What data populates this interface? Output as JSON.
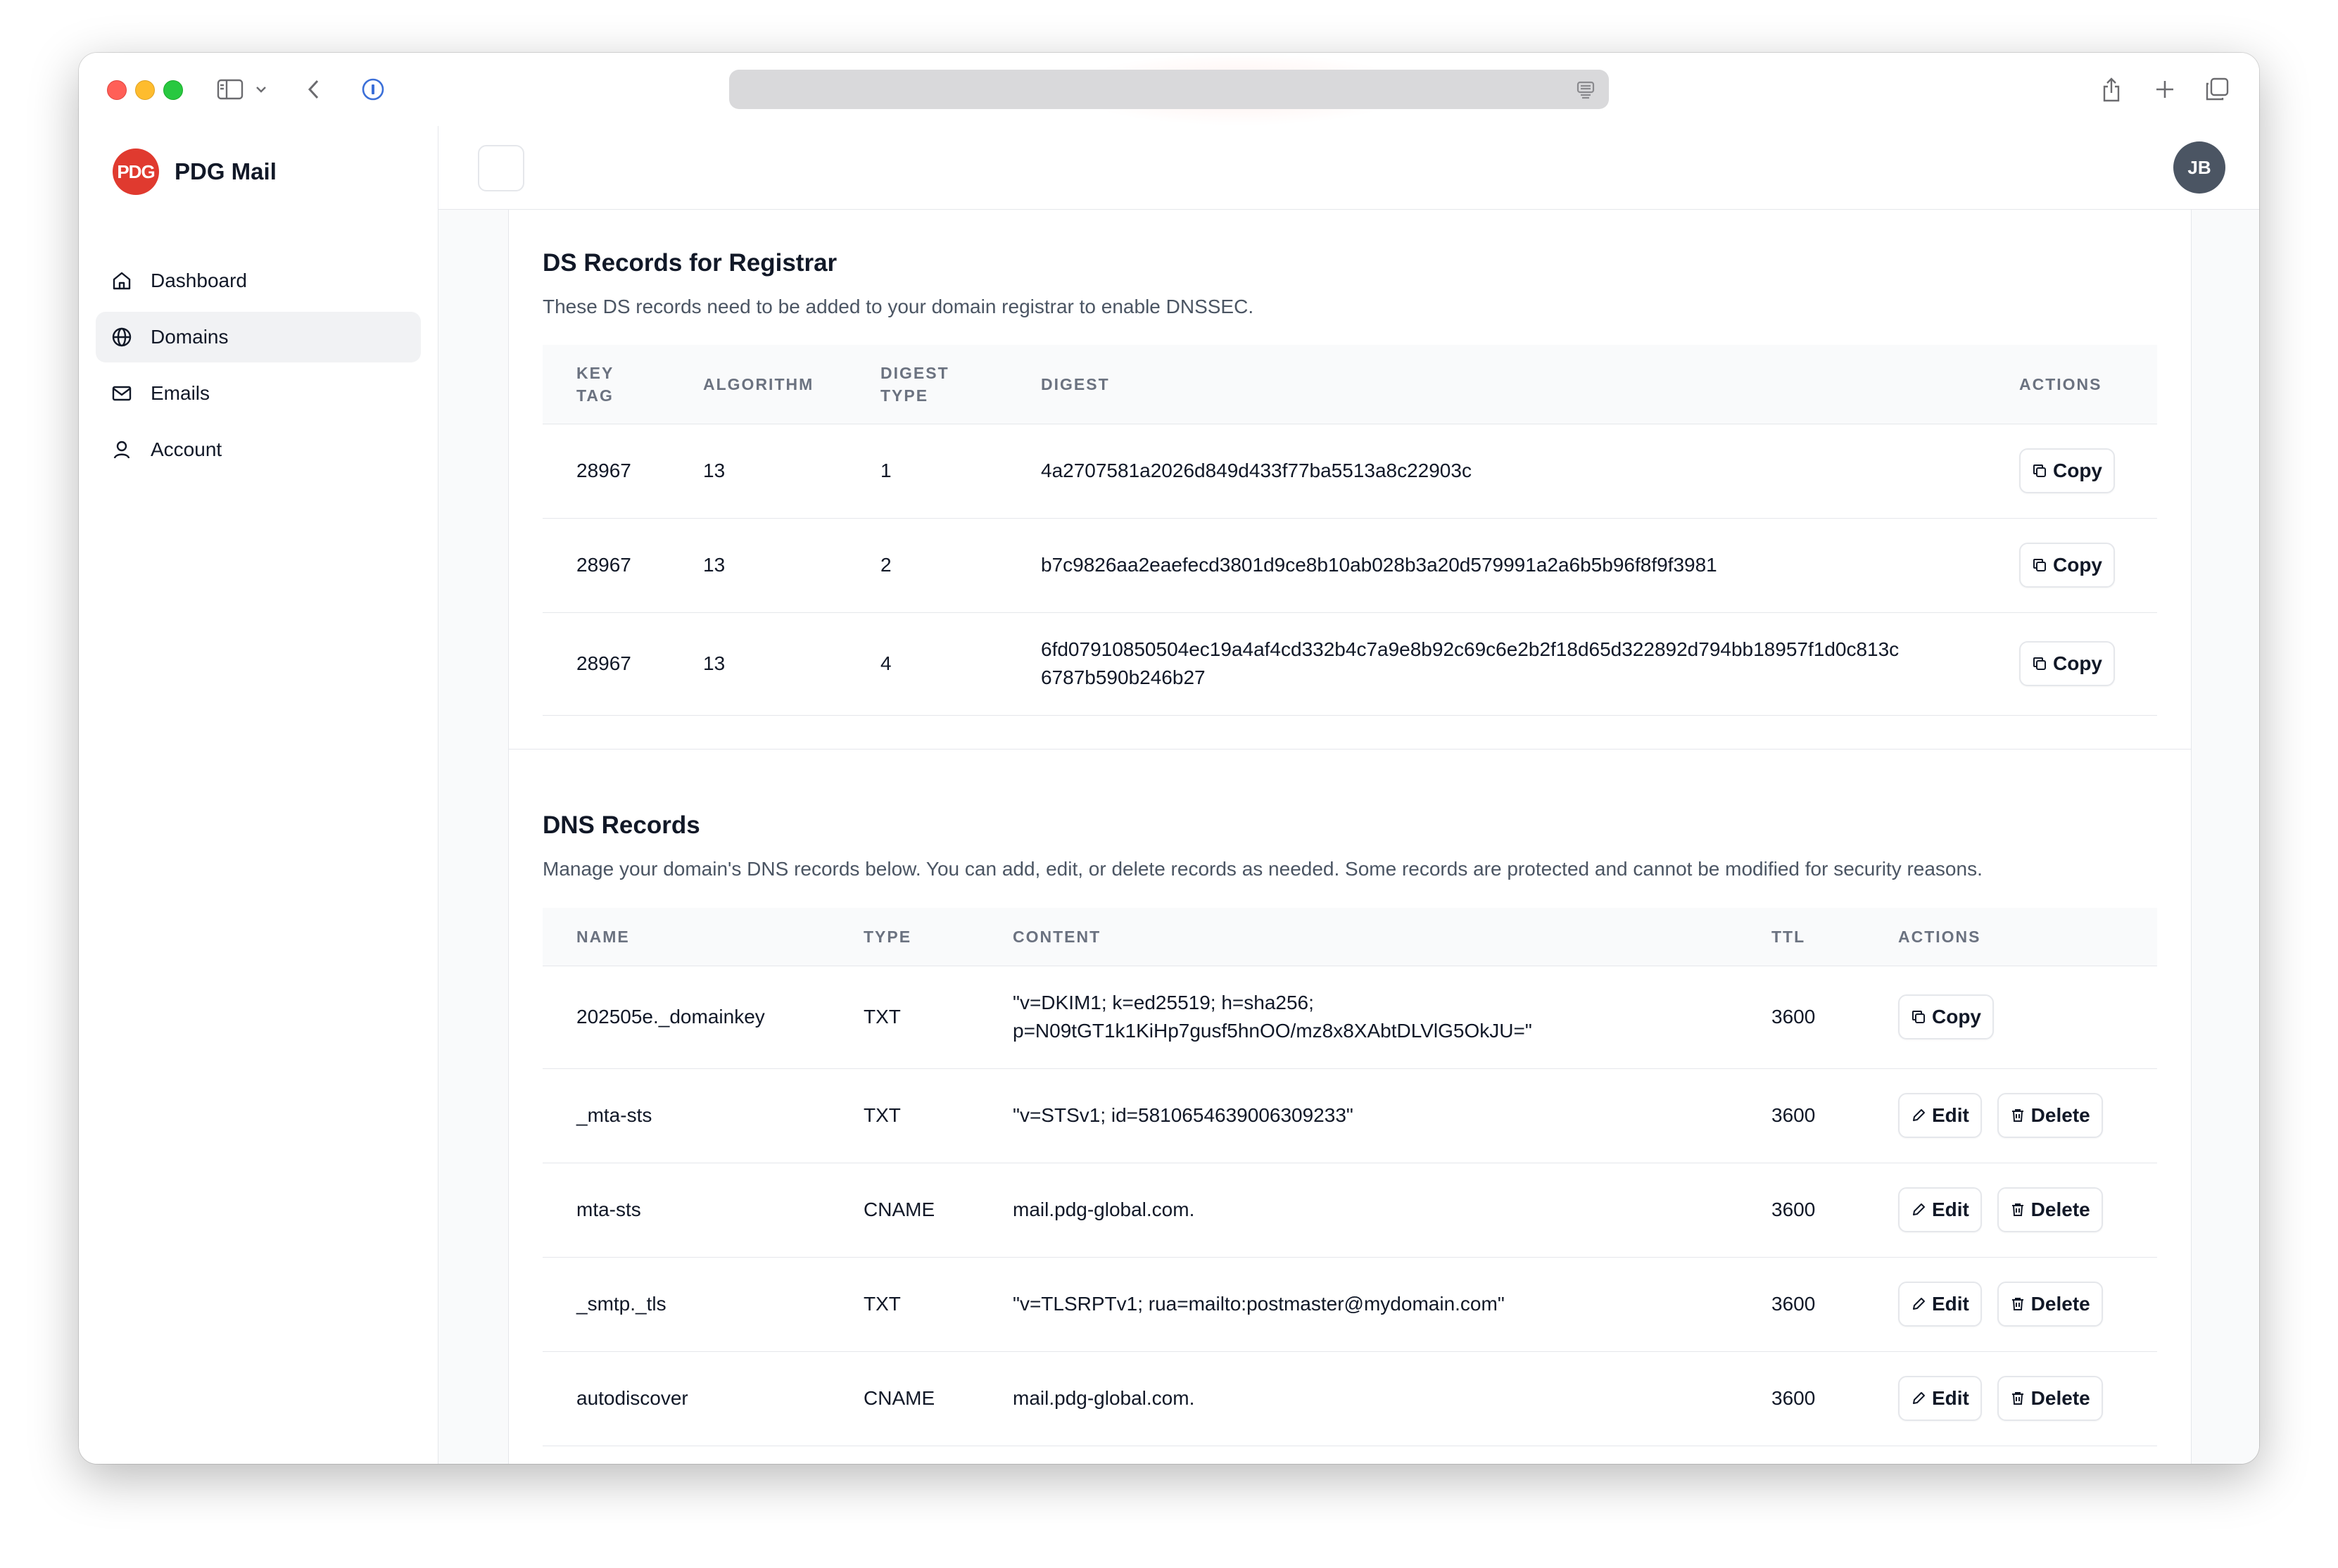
{
  "app": {
    "brand_logo_text": "PDG",
    "brand_name": "PDG Mail",
    "avatar_initials": "JB"
  },
  "nav": [
    {
      "label": "Dashboard",
      "icon": "home-icon",
      "active": false
    },
    {
      "label": "Domains",
      "icon": "globe-icon",
      "active": true
    },
    {
      "label": "Emails",
      "icon": "mail-icon",
      "active": false
    },
    {
      "label": "Account",
      "icon": "user-icon",
      "active": false
    }
  ],
  "ds": {
    "title": "DS Records for Registrar",
    "description": "These DS records need to be added to your domain registrar to enable DNSSEC.",
    "headers": {
      "key_tag_1": "KEY",
      "key_tag_2": "TAG",
      "algorithm": "ALGORITHM",
      "digest_type_1": "DIGEST",
      "digest_type_2": "TYPE",
      "digest": "DIGEST",
      "actions": "ACTIONS"
    },
    "copy_label": "Copy",
    "rows": [
      {
        "key_tag": "28967",
        "algorithm": "13",
        "digest_type": "1",
        "digest_1": "4a2707581a2026d849d433f77ba5513a8c22903c",
        "digest_2": ""
      },
      {
        "key_tag": "28967",
        "algorithm": "13",
        "digest_type": "2",
        "digest_1": "b7c9826aa2eaefecd3801d9ce8b10ab028b3a20d579991a2a6b5b96f8f9f3981",
        "digest_2": ""
      },
      {
        "key_tag": "28967",
        "algorithm": "13",
        "digest_type": "4",
        "digest_1": "6fd07910850504ec19a4af4cd332b4c7a9e8b92c69c6e2b2f18d65d322892d794bb18957f1d0c813c",
        "digest_2": "6787b590b246b27"
      }
    ]
  },
  "dns": {
    "title": "DNS Records",
    "description": "Manage your domain's DNS records below. You can add, edit, or delete records as needed. Some records are protected and cannot be modified for security reasons.",
    "headers": {
      "name": "NAME",
      "type": "TYPE",
      "content": "CONTENT",
      "ttl": "TTL",
      "actions": "ACTIONS"
    },
    "copy_label": "Copy",
    "edit_label": "Edit",
    "delete_label": "Delete",
    "rows": [
      {
        "name": "202505e._domainkey",
        "type": "TXT",
        "content_1": "\"v=DKIM1; k=ed25519; h=sha256;",
        "content_2": "p=N09tGT1k1KiHp7gusf5hnOO/mz8x8XAbtDLVlG5OkJU=\"",
        "ttl": "3600",
        "protected": true
      },
      {
        "name": "_mta-sts",
        "type": "TXT",
        "content_1": "\"v=STSv1; id=5810654639006309233\"",
        "content_2": "",
        "ttl": "3600",
        "protected": false
      },
      {
        "name": "mta-sts",
        "type": "CNAME",
        "content_1": "mail.pdg-global.com.",
        "content_2": "",
        "ttl": "3600",
        "protected": false
      },
      {
        "name": "_smtp._tls",
        "type": "TXT",
        "content_1": "\"v=TLSRPTv1; rua=mailto:postmaster@mydomain.com\"",
        "content_2": "",
        "ttl": "3600",
        "protected": false
      },
      {
        "name": "autodiscover",
        "type": "CNAME",
        "content_1": "mail.pdg-global.com.",
        "content_2": "",
        "ttl": "3600",
        "protected": false
      }
    ]
  }
}
